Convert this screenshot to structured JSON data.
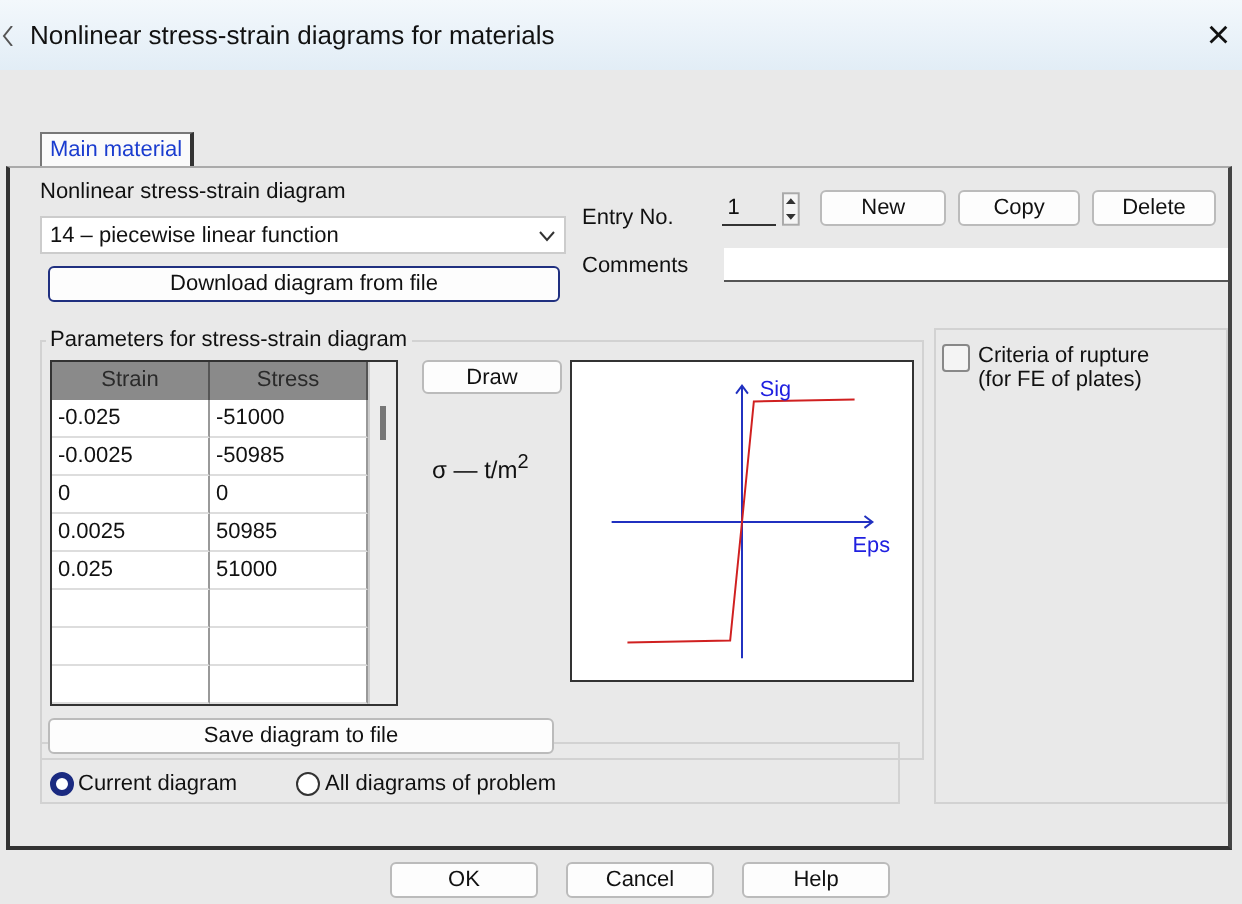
{
  "window": {
    "title": "Nonlinear stress-strain diagrams for materials",
    "close": "×"
  },
  "tabs": [
    {
      "label": "Main material",
      "selected": true
    }
  ],
  "diagram": {
    "label": "Nonlinear stress-strain diagram",
    "value": "14 – piecewise linear function",
    "download_button": "Download diagram from file"
  },
  "entry": {
    "label": "Entry No.",
    "value": "1",
    "buttons": [
      "New",
      "Copy",
      "Delete"
    ]
  },
  "comments": {
    "label": "Comments"
  },
  "parameters": {
    "legend": "Parameters for stress-strain diagram",
    "columns": [
      "Strain",
      "Stress"
    ],
    "rows": [
      [
        "-0.025",
        "-51000"
      ],
      [
        "-0.0025",
        "-50985"
      ],
      [
        "0",
        "0"
      ],
      [
        "0.0025",
        "50985"
      ],
      [
        "0.025",
        "51000"
      ]
    ],
    "draw_button": "Draw",
    "units": "σ — t/m$^{2}$",
    "plot": {
      "y_label": "Sig",
      "x_label": "Eps"
    }
  },
  "rupture": {
    "label": "Criteria of rupture (for FE of plates)",
    "checked": false
  },
  "save_button": "Save diagram to file",
  "scope": [
    {
      "label": "Current diagram",
      "selected": true
    },
    {
      "label": "All diagrams of problem",
      "selected": false
    }
  ],
  "buttons": [
    "OK",
    "Cancel",
    "Help"
  ]
}
